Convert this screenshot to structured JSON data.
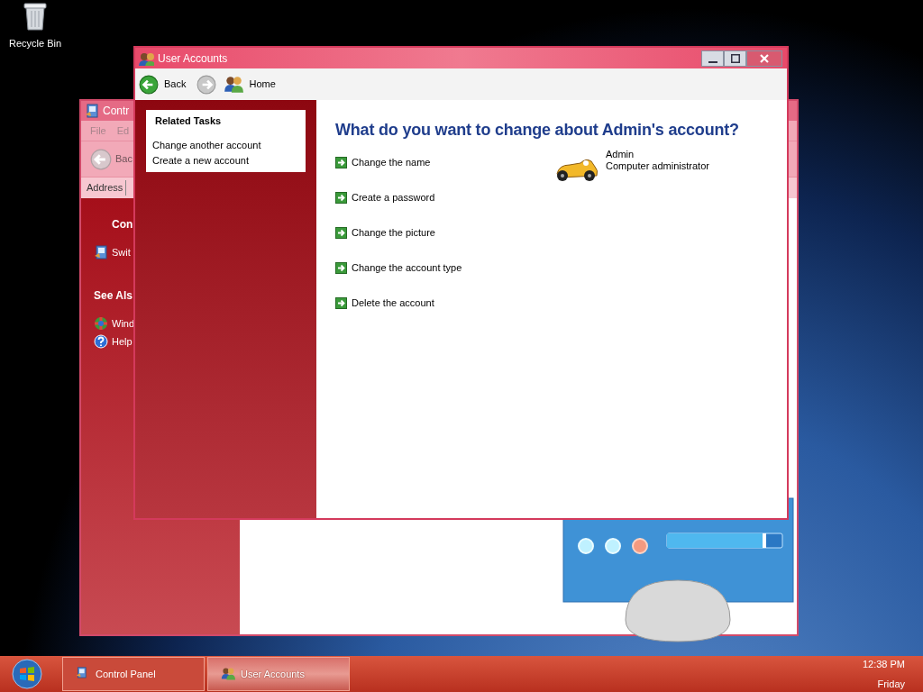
{
  "desktop_icons": [
    {
      "label": "Recycle Bin"
    }
  ],
  "background_window": {
    "title": "Contr",
    "menu": [
      "File",
      "Ed"
    ],
    "back_label": "Bac",
    "address_label": "Address",
    "sidebar": [
      {
        "kind": "heading",
        "label": "Con"
      },
      {
        "kind": "link",
        "label": "Swit"
      },
      {
        "kind": "heading",
        "label": "See Als"
      },
      {
        "kind": "link",
        "label": "Wind"
      },
      {
        "kind": "link",
        "label": "Help"
      }
    ]
  },
  "window": {
    "title": "User Accounts",
    "toolbar": [
      {
        "kind": "back",
        "label": "Back",
        "disabled": false
      },
      {
        "kind": "forward",
        "disabled": true
      },
      {
        "kind": "home",
        "label": "Home"
      }
    ],
    "related_tasks": {
      "title": "Related Tasks",
      "items": [
        "Change another account",
        "Create a new account"
      ]
    },
    "heading": "What do you want to change about Admin's account?",
    "actions": [
      "Change the name",
      "Create a password",
      "Change the picture",
      "Change the account type",
      "Delete the account"
    ],
    "account": {
      "name": "Admin",
      "type": "Computer administrator"
    }
  },
  "taskbar": {
    "buttons": [
      {
        "label": "Control Panel",
        "selected": false
      },
      {
        "label": "User Accounts",
        "selected": true
      }
    ],
    "clock": {
      "time": "12:38 PM",
      "day": "Friday"
    }
  }
}
